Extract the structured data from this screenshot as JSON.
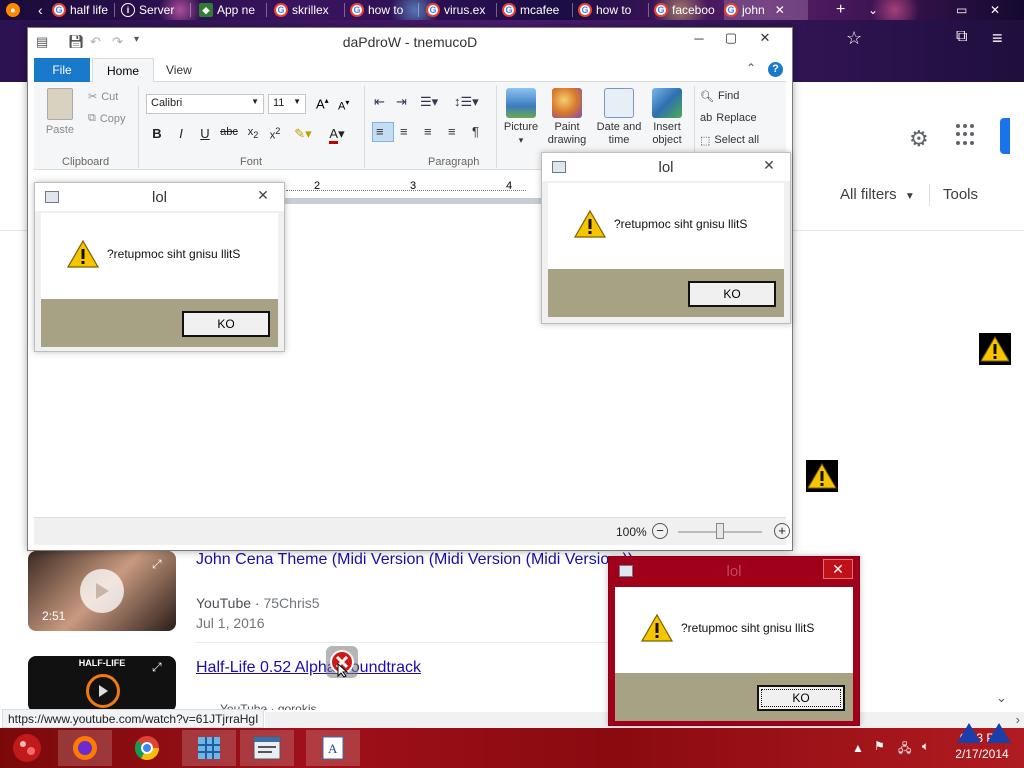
{
  "browser": {
    "tabs": [
      {
        "label": "half life",
        "icon": "google"
      },
      {
        "label": "Server",
        "icon": "info"
      },
      {
        "label": "App ne",
        "icon": "puzzle"
      },
      {
        "label": "skrillex",
        "icon": "google"
      },
      {
        "label": "how to",
        "icon": "google"
      },
      {
        "label": "virus.ex",
        "icon": "google"
      },
      {
        "label": "mcafee",
        "icon": "google"
      },
      {
        "label": "how to",
        "icon": "google"
      },
      {
        "label": "faceboo",
        "icon": "google"
      },
      {
        "label": "john",
        "icon": "google"
      }
    ],
    "new_tab": "+",
    "status_url": "https://www.youtube.com/watch?v=61JTjrraHgI"
  },
  "google": {
    "all_filters": "All filters",
    "tools": "Tools",
    "results": [
      {
        "title": "John Cena Theme (Midi Version (Midi Version (Midi Versio...))",
        "source": "YouTube",
        "channel": "75Chris5",
        "date": "Jul 1, 2016",
        "duration": "2:51"
      },
      {
        "title": "Half-Life 0.52 Alpha Soundtrack",
        "thumb_text": "HALF-LIFE",
        "source_partial": "YouTube · gorokis"
      }
    ]
  },
  "wordpad": {
    "title": "daPdroW - tnemucoD",
    "tabs": {
      "file": "File",
      "home": "Home",
      "view": "View"
    },
    "clipboard": {
      "paste": "Paste",
      "cut": "Cut",
      "copy": "Copy",
      "label": "Clipboard"
    },
    "font": {
      "family": "Calibri",
      "size": "11",
      "label": "Font"
    },
    "paragraph": {
      "label": "Paragraph"
    },
    "insert": [
      {
        "label1": "Picture",
        "label2": ""
      },
      {
        "label1": "Paint",
        "label2": "drawing"
      },
      {
        "label1": "Date and",
        "label2": "time"
      },
      {
        "label1": "Insert",
        "label2": "object"
      }
    ],
    "editing": {
      "find": "Find",
      "replace": "Replace",
      "select_all": "Select all"
    },
    "ruler": [
      "2",
      "3",
      "4"
    ],
    "zoom": "100%"
  },
  "dialogs": [
    {
      "title": "lol",
      "message": "?retupmoc siht gnisu llitS",
      "button": "KO"
    },
    {
      "title": "lol",
      "message": "?retupmoc siht gnisu llitS",
      "button": "KO"
    },
    {
      "title": "lol",
      "message": "?retupmoc siht gnisu llitS",
      "button": "KO"
    }
  ],
  "taskbar": {
    "time": "6:23 PM",
    "date": "2/17/2014"
  },
  "colors": {
    "file_tab": "#1979ca",
    "dialog_footer": "#a8a284",
    "taskbar": "#a0101a",
    "link": "#1a0dab"
  }
}
